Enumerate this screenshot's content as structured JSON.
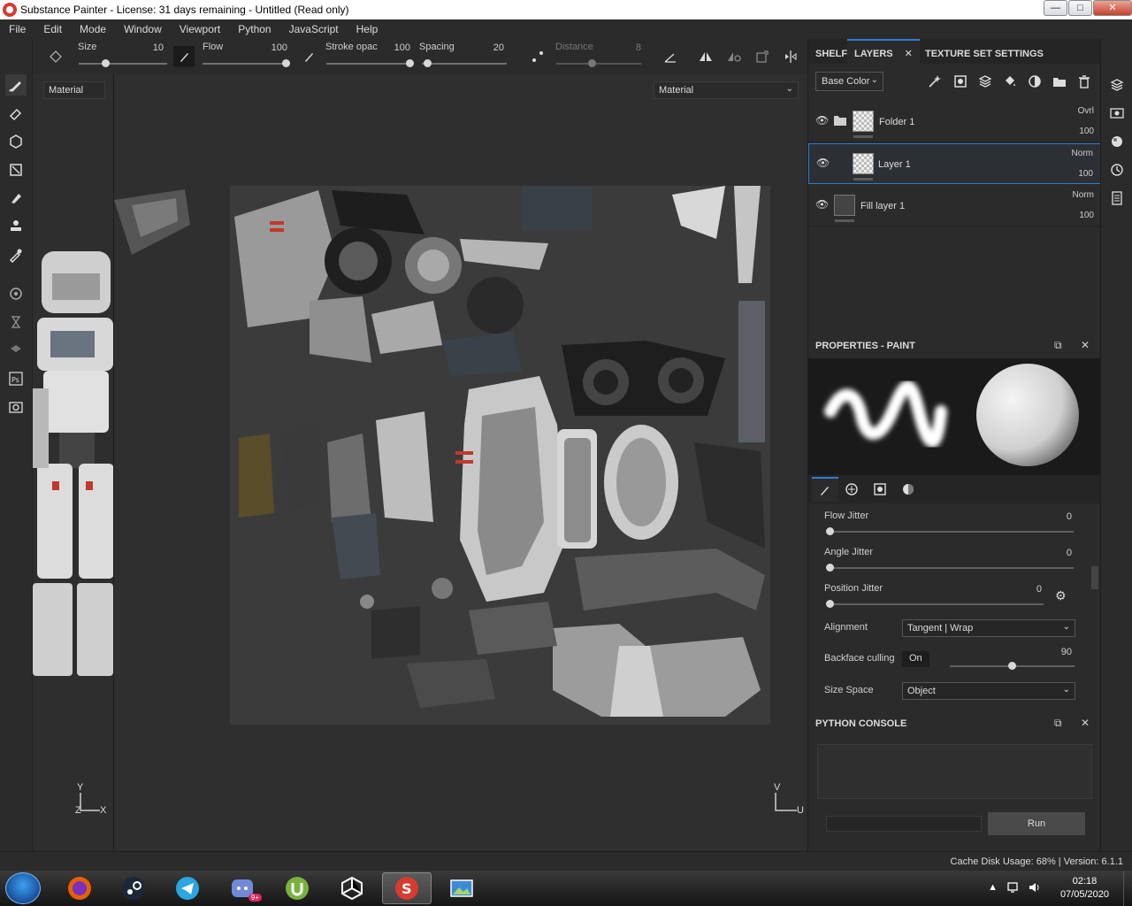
{
  "window": {
    "title": "Substance Painter - License: 31 days remaining - Untitled (Read only)",
    "controls": [
      "—",
      "□",
      "✕"
    ]
  },
  "menu": [
    "File",
    "Edit",
    "Mode",
    "Window",
    "Viewport",
    "Python",
    "JavaScript",
    "Help"
  ],
  "tool_options": {
    "size_label": "Size",
    "size_value": "10",
    "flow_label": "Flow",
    "flow_value": "100",
    "stroke_opacity_label": "Stroke opac",
    "stroke_opacity_value": "100",
    "spacing_label": "Spacing",
    "spacing_value": "20",
    "distance_label": "Distance",
    "distance_value": "8"
  },
  "viewport": {
    "left_mode": "Material",
    "right_mode": "Material",
    "axis_left": {
      "y": "Y",
      "z": "Z",
      "x": "X"
    },
    "axis_right": {
      "v": "V",
      "u": "U"
    }
  },
  "dock": {
    "tabs": [
      "SHELF",
      "LAYERS",
      "TEXTURE SET SETTINGS"
    ],
    "tab_close": "✕",
    "channel": "Base Color",
    "layers": [
      {
        "name": "Folder 1",
        "blend": "Ovrl",
        "opacity": "100"
      },
      {
        "name": "Layer 1",
        "blend": "Norm",
        "opacity": "100"
      },
      {
        "name": "Fill layer 1",
        "blend": "Norm",
        "opacity": "100"
      }
    ],
    "properties_title": "PROPERTIES - PAINT",
    "properties": {
      "flow_jitter_label": "Flow Jitter",
      "flow_jitter_value": "0",
      "angle_jitter_label": "Angle Jitter",
      "angle_jitter_value": "0",
      "position_jitter_label": "Position Jitter",
      "position_jitter_value": "0",
      "alignment_label": "Alignment",
      "alignment_value": "Tangent | Wrap",
      "backface_label": "Backface culling",
      "backface_toggle": "On",
      "backface_value": "90",
      "size_space_label": "Size Space",
      "size_space_value": "Object"
    },
    "console_title": "PYTHON CONSOLE",
    "run_label": "Run"
  },
  "status": {
    "text": "Cache Disk Usage:   68% | Version: 6.1.1"
  },
  "taskbar": {
    "time": "02:18",
    "date": "07/05/2020",
    "discord_badge": "9+"
  },
  "colors": {
    "accent": "#2e7bd6",
    "panel": "#2b2b2b",
    "viewport": "#2f2f2f"
  }
}
